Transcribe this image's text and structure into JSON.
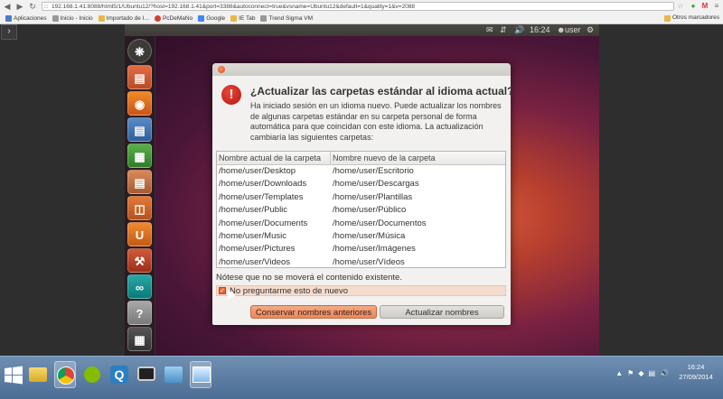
{
  "browser": {
    "url": "192.168.1.41:8088/html5/1/Ubuntu12/?host=192.168.1.41&port=3388&autoconnect=true&vsname=Ubuntu12&default=1&quality=1&v=2088",
    "bookmarks": [
      {
        "label": "Aplicaciones",
        "color": "#4a7cc7"
      },
      {
        "label": "Inicio - Inicio",
        "color": "#999999"
      },
      {
        "label": "Importado de I...",
        "color": "#e6b84c"
      },
      {
        "label": "PcDeMaNo",
        "color": "#d04030"
      },
      {
        "label": "Google",
        "color": "#4285f4"
      },
      {
        "label": "IE Tab",
        "color": "#e6b84c"
      },
      {
        "label": "Trend Sigma VM",
        "color": "#999999"
      }
    ],
    "other_bookmarks": "Otros marcadores"
  },
  "panel": {
    "time": "16:24",
    "user": "user"
  },
  "dialog": {
    "heading": "¿Actualizar las carpetas estándar al idioma actual?",
    "body": "Ha iniciado sesión en un idioma nuevo. Puede actualizar los nombres de algunas carpetas estándar en su carpeta personal de forma automática para que coincidan con este idioma. La actualización cambiaría las siguientes carpetas:",
    "columns": [
      "Nombre actual de la carpeta",
      "Nombre nuevo de la carpeta"
    ],
    "rows": [
      [
        "/home/user/Desktop",
        "/home/user/Escritorio"
      ],
      [
        "/home/user/Downloads",
        "/home/user/Descargas"
      ],
      [
        "/home/user/Templates",
        "/home/user/Plantillas"
      ],
      [
        "/home/user/Public",
        "/home/user/Público"
      ],
      [
        "/home/user/Documents",
        "/home/user/Documentos"
      ],
      [
        "/home/user/Music",
        "/home/user/Música"
      ],
      [
        "/home/user/Pictures",
        "/home/user/Imágenes"
      ],
      [
        "/home/user/Videos",
        "/home/user/Vídeos"
      ]
    ],
    "note": "Nótese que no se moverá el contenido existente.",
    "checkbox_label": "No preguntarme esto de nuevo",
    "checkbox_checked": true,
    "btn_keep": "Conservar nombres anteriores",
    "btn_update": "Actualizar nombres"
  },
  "taskbar": {
    "time": "16:24",
    "date": "27/09/2014"
  },
  "colors": {
    "accent": "#e98860",
    "ubuntu_orange": "#dd4814",
    "taskbar": "#5a7ba3"
  }
}
